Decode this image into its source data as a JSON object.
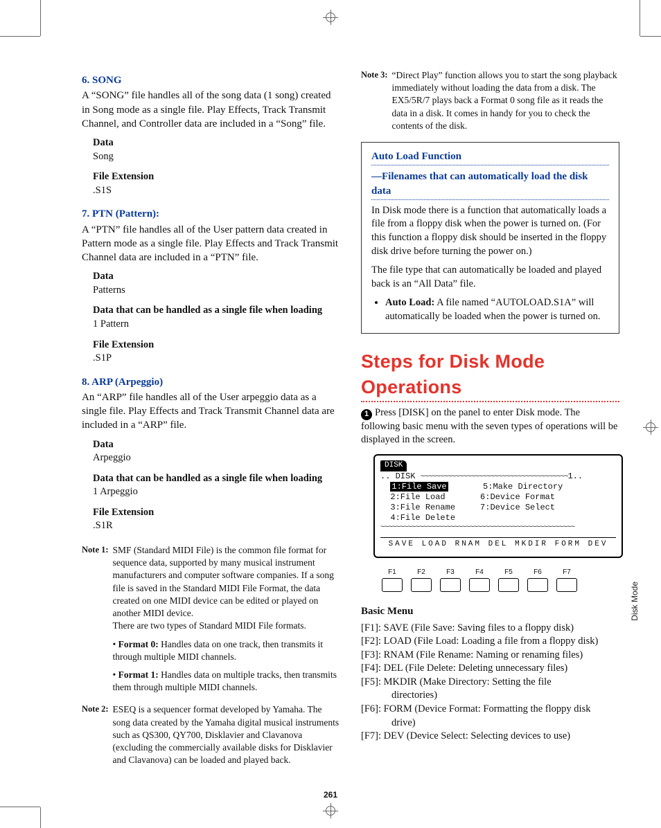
{
  "page_number": "261",
  "side_label": "Disk Mode",
  "left": {
    "sec6": {
      "title": "6. SONG",
      "body": "A “SONG” file handles all of the song data (1 song) created in Song mode as a single file. Play Effects, Track Transmit Channel, and Controller data are included in a “Song” file.",
      "data_label": "Data",
      "data_val": "Song",
      "ext_label": "File Extension",
      "ext_val": ".S1S"
    },
    "sec7": {
      "title": "7. PTN (Pattern):",
      "body": "A “PTN” file handles all of the User pattern data created in Pattern mode as a single file. Play Effects and Track Transmit Channel data are included in a “PTN” file.",
      "data_label": "Data",
      "data_val": "Patterns",
      "load_label": "Data that can be handled as a single file when loading",
      "load_val": "1 Pattern",
      "ext_label": "File Extension",
      "ext_val": ".S1P"
    },
    "sec8": {
      "title": "8. ARP (Arpeggio)",
      "body": "An “ARP” file handles all of the User arpeggio data as a single file. Play Effects and Track Transmit Channel data are included in a “ARP” file.",
      "data_label": "Data",
      "data_val": "Arpeggio",
      "load_label": "Data that can be handled as a single file when loading",
      "load_val": "1 Arpeggio",
      "ext_label": "File Extension",
      "ext_val": ".S1R"
    },
    "note1": {
      "tag": "Note 1:",
      "body": "SMF (Standard MIDI File) is the common file format for sequence data, supported by many musical instrument manufacturers and computer software companies. If a song file is saved in the Standard MIDI File Format, the data created on one MIDI device can be edited or played on another MIDI device.",
      "body2": "There are two types of Standard MIDI File formats.",
      "f0_b": "Format 0:",
      "f0_t": " Handles data on one track, then transmits it through multiple MIDI channels.",
      "f1_b": "Format 1:",
      "f1_t": " Handles data on multiple tracks, then transmits them through multiple MIDI channels."
    },
    "note2": {
      "tag": "Note 2:",
      "body": "ESEQ is a sequencer format developed by Yamaha. The song data created by the Yamaha digital musical instruments such as QS300, QY700, Disklavier and Clavanova (excluding the commercially available disks for Disklavier and Clavanova) can be loaded and played back."
    }
  },
  "right": {
    "note3": {
      "tag": "Note 3:",
      "body": "“Direct Play” function allows you to start the song playback immediately without loading the data from a disk. The EX5/5R/7 plays back a Format 0 song file as it reads the data in a disk. It comes in handy for you to check the contents of the disk."
    },
    "box": {
      "title1": "Auto Load Function",
      "title2": "—Filenames that can automatically load the disk data",
      "p1": "In Disk mode there is a function that automatically loads a file from a floppy disk when the power is turned on. (For this function a floppy disk should be inserted in the floppy disk drive before turning the power on.)",
      "p2": "The file type that can automatically be loaded and played back is an “All Data” file.",
      "al_b": "Auto Load:",
      "al_t": " A file named “AUTOLOAD.S1A” will automatically be loaded when the power is turned on."
    },
    "heading": "Steps for Disk Mode Operations",
    "step1": "Press [DISK] on the panel to enter Disk mode. The following basic menu with the seven types of operations will be displayed in the screen.",
    "lcd": {
      "tab": "DISK",
      "hdr": "DISK",
      "i1": "1:File Save",
      "i2": "2:File Load",
      "i3": "3:File Rename",
      "i4": "4:File Delete",
      "i5": "5:Make Directory",
      "i6": "6:Device Format",
      "i7": "7:Device Select",
      "bar": "SAVE LOAD RNAM DEL  MKDIR FORM DEV",
      "f1": "F1",
      "f2": "F2",
      "f3": "F3",
      "f4": "F4",
      "f5": "F5",
      "f6": "F6",
      "f7": "F7"
    },
    "basic": {
      "title": "Basic Menu",
      "m1": "[F1]: SAVE (File Save: Saving files to a floppy disk)",
      "m2": "[F2]: LOAD (File Load: Loading a file from a floppy disk)",
      "m3": "[F3]: RNAM (File Rename: Naming or renaming files)",
      "m4": "[F4]: DEL (File Delete: Deleting unnecessary files)",
      "m5a": "[F5]: MKDIR (Make Directory: Setting the file",
      "m5b": "directories)",
      "m6a": "[F6]: FORM (Device Format: Formatting the floppy disk",
      "m6b": "drive)",
      "m7": "[F7]: DEV (Device Select: Selecting devices to use)"
    }
  }
}
